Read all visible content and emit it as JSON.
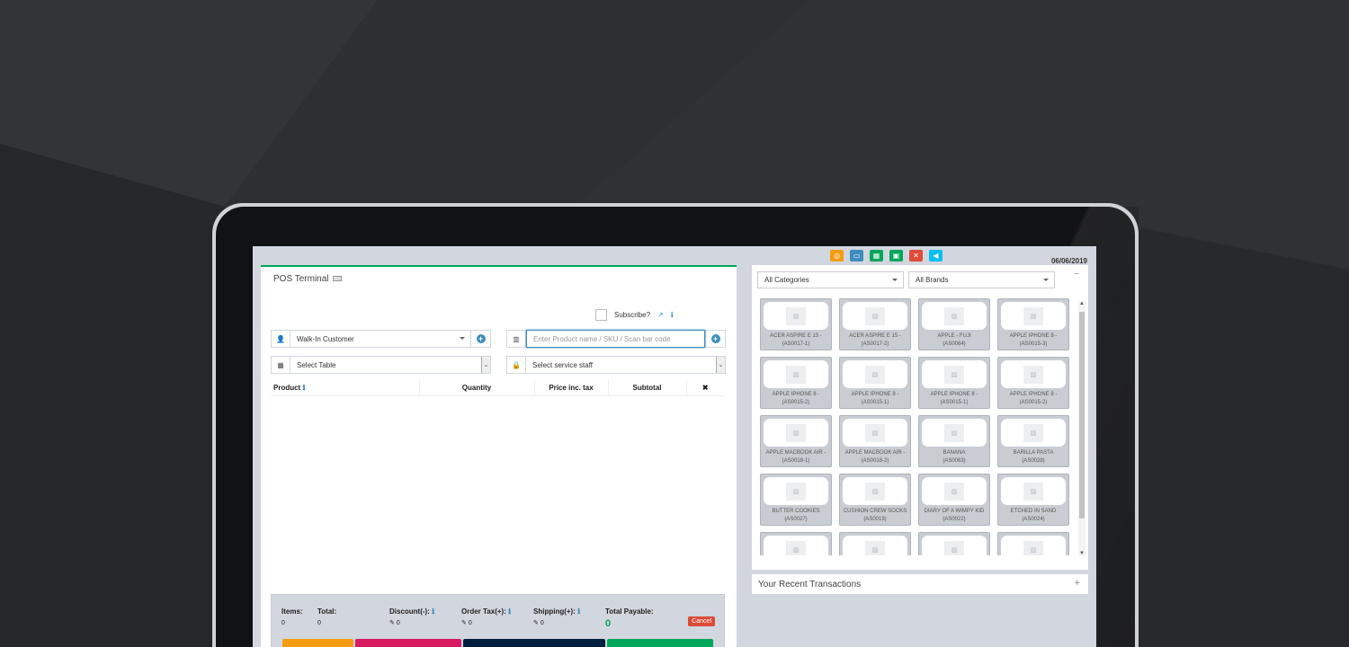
{
  "colors": {
    "accent_green": "#00a65a",
    "primary_blue": "#3c8dbc",
    "danger_red": "#dd4b39",
    "panel_bg": "#d2d6de"
  },
  "toolbar": {
    "icons": [
      {
        "name": "suspended-sales-icon",
        "color": "#f39c12",
        "glyph": "◎"
      },
      {
        "name": "full-screen-icon",
        "color": "#3c8dbc",
        "glyph": "▭"
      },
      {
        "name": "calculator-icon",
        "color": "#00a65a",
        "glyph": "▦"
      },
      {
        "name": "register-details-icon",
        "color": "#00a65a",
        "glyph": "▣"
      },
      {
        "name": "close-register-icon",
        "color": "#dd4b39",
        "glyph": "✕"
      },
      {
        "name": "go-back-icon",
        "color": "#00c0ef",
        "glyph": "◀"
      }
    ],
    "date": "06/06/2019"
  },
  "pos": {
    "title": "POS Terminal",
    "subscribe_label": "Subscribe?",
    "customer": "Walk-In Customer",
    "product_placeholder": "Enter Product name / SKU / Scan bar code",
    "table_select": "Select Table",
    "staff_select": "Select service staff",
    "columns": [
      "Product",
      "Quantity",
      "Price inc. tax",
      "Subtotal",
      "✖"
    ]
  },
  "totals": {
    "items_label": "Items:",
    "items_value": "0",
    "total_label": "Total:",
    "total_value": "0",
    "discount_label": "Discount(-):",
    "discount_value": "0",
    "tax_label": "Order Tax(+):",
    "tax_value": "0",
    "shipping_label": "Shipping(+):",
    "shipping_value": "0",
    "payable_label": "Total Payable:",
    "payable_value": "0",
    "cancel_label": "Cancel"
  },
  "actions": [
    {
      "color": "#f39c12"
    },
    {
      "color": "#d81b60"
    },
    {
      "color": "#001f3f"
    },
    {
      "color": "#00a65a"
    }
  ],
  "filters": {
    "categories": "All Categories",
    "brands": "All Brands"
  },
  "products": [
    {
      "name": "ACER ASPIRE E 15 -",
      "sku": "(AS0017-1)"
    },
    {
      "name": "ACER ASPIRE E 15 -",
      "sku": "(AS0017-2)"
    },
    {
      "name": "APPLE - FUJI",
      "sku": "(AS0064)"
    },
    {
      "name": "APPLE IPHONE 8 -",
      "sku": "(AS0015-3)"
    },
    {
      "name": "APPLE IPHONE 8 -",
      "sku": "(AS0015-2)"
    },
    {
      "name": "APPLE IPHONE 8 -",
      "sku": "(AS0015-1)"
    },
    {
      "name": "APPLE IPHONE 8 -",
      "sku": "(AS0015-1)"
    },
    {
      "name": "APPLE IPHONE 8 -",
      "sku": "(AS0015-2)"
    },
    {
      "name": "APPLE MACBOOK AIR -",
      "sku": "(AS0018-1)"
    },
    {
      "name": "APPLE MACBOOK AIR -",
      "sku": "(AS0018-2)"
    },
    {
      "name": "BANANA",
      "sku": "(AS0063)"
    },
    {
      "name": "BARILLA PASTA",
      "sku": "(AS0028)"
    },
    {
      "name": "BUTTER COOKIES",
      "sku": "(AS0027)"
    },
    {
      "name": "CUSHION CREW SOCKS",
      "sku": "(AS0019)"
    },
    {
      "name": "DIARY OF A WIMPY KID",
      "sku": "(AS0022)"
    },
    {
      "name": "ETCHED IN SAND",
      "sku": "(AS0024)"
    },
    {
      "name": "",
      "sku": ""
    },
    {
      "name": "",
      "sku": ""
    },
    {
      "name": "",
      "sku": ""
    },
    {
      "name": "",
      "sku": ""
    }
  ],
  "recent": {
    "title": "Your Recent Transactions"
  }
}
